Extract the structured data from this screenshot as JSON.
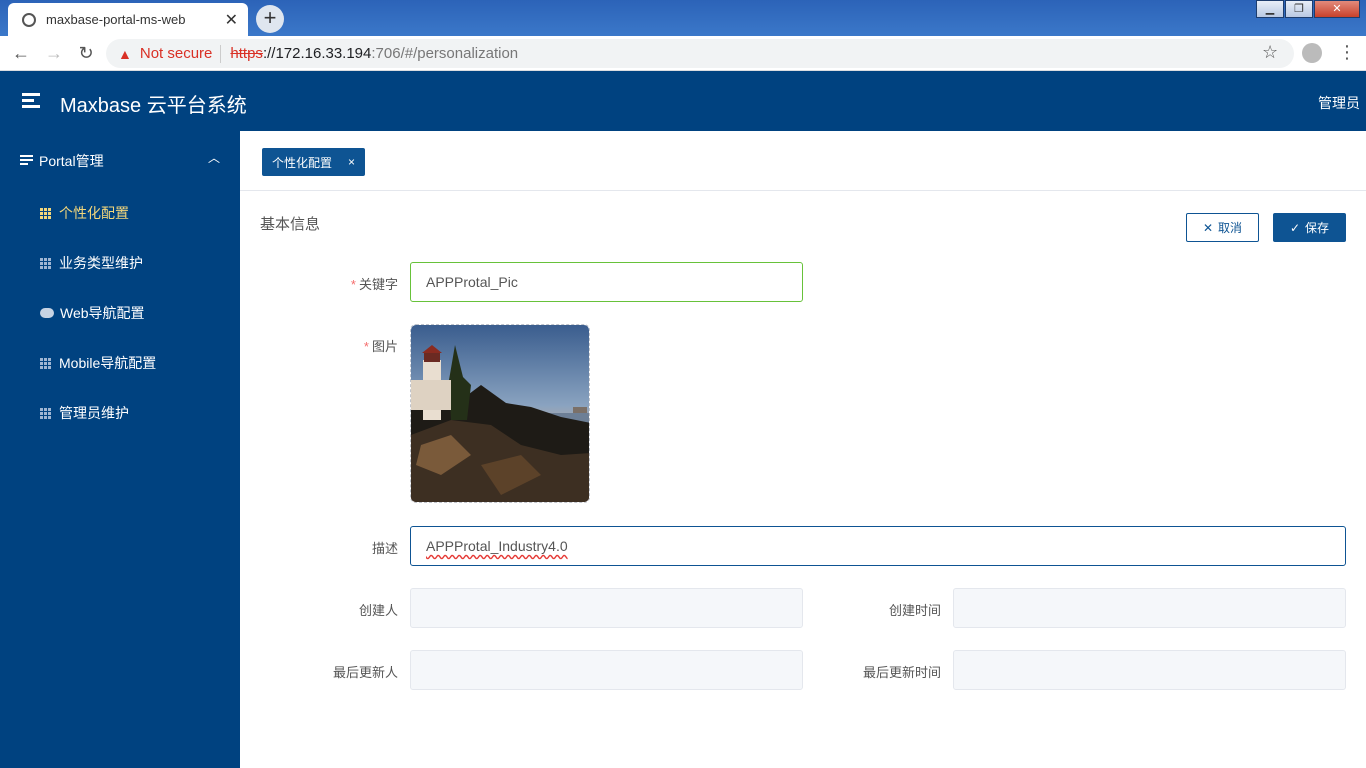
{
  "browser": {
    "tab_title": "maxbase-portal-ms-web",
    "tab_close": "✕",
    "new_tab": "+",
    "not_secure": "Not secure",
    "url_scheme": "https",
    "url_host": "://172.16.33.194",
    "url_rest": ":706/#/personalization"
  },
  "header": {
    "title": "Maxbase 云平台系统",
    "user": "管理员"
  },
  "sidebar": {
    "group_label": "Portal管理",
    "items": [
      {
        "label": "个性化配置",
        "icon": "grid-icon",
        "active": true
      },
      {
        "label": "业务类型维护",
        "icon": "grid-icon",
        "active": false
      },
      {
        "label": "Web导航配置",
        "icon": "cloud-icon",
        "active": false
      },
      {
        "label": "Mobile导航配置",
        "icon": "grid-icon",
        "active": false
      },
      {
        "label": "管理员维护",
        "icon": "grid-icon",
        "active": false
      }
    ]
  },
  "tabs": {
    "active_label": "个性化配置",
    "close": "×"
  },
  "form": {
    "section_title": "基本信息",
    "cancel_label": "取消",
    "save_label": "保存",
    "keyword_label": "关键字",
    "keyword_value": "APPProtal_Pic",
    "image_label": "图片",
    "desc_label": "描述",
    "desc_value": "APPProtal_Industry4.0",
    "creator_label": "创建人",
    "creator_value": "",
    "created_time_label": "创建时间",
    "created_time_value": "",
    "updater_label": "最后更新人",
    "updater_value": "",
    "updated_time_label": "最后更新时间",
    "updated_time_value": "",
    "required_mark": "*"
  },
  "colors": {
    "brand": "#004280",
    "accent": "#0e5493",
    "active_menu": "#f2d67b",
    "required": "#f56c6c"
  }
}
